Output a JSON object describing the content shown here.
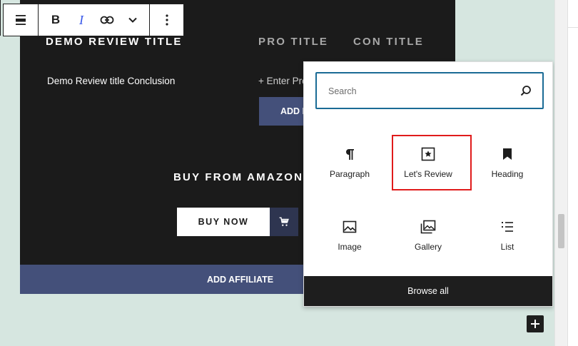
{
  "review": {
    "title": "DEMO REVIEW  TITLE",
    "pro_title": "PRO TITLE",
    "con_title": "CON TITLE",
    "conclusion": "Demo Review  title Conclusion",
    "enter_pro": "+ Enter Pro",
    "add_pro_label": "ADD PRO",
    "buy_title": "BUY FROM AMAZON",
    "buy_now_label": "BUY NOW",
    "add_affiliate_label": "ADD AFFILIATE"
  },
  "toolbar": {
    "align_icon": "align-icon",
    "bold_label": "B",
    "italic_label": "I",
    "link_icon": "link-icon",
    "more_icon": "chevron-down-icon",
    "options_icon": "more-vertical-icon"
  },
  "inserter": {
    "search_placeholder": "Search",
    "blocks": [
      {
        "label": "Paragraph",
        "icon": "paragraph-icon"
      },
      {
        "label": "Let's Review",
        "icon": "star-square-icon",
        "highlighted": true
      },
      {
        "label": "Heading",
        "icon": "bookmark-icon"
      },
      {
        "label": "Image",
        "icon": "image-icon"
      },
      {
        "label": "Gallery",
        "icon": "gallery-icon"
      },
      {
        "label": "List",
        "icon": "list-icon"
      }
    ],
    "browse_all_label": "Browse all"
  },
  "colors": {
    "dark_bg": "#1b1b1b",
    "accent_blue": "#44507a",
    "focus_blue": "#1a6b95",
    "highlight_red": "#e01b1b",
    "page_bg": "#d6e6e0"
  }
}
